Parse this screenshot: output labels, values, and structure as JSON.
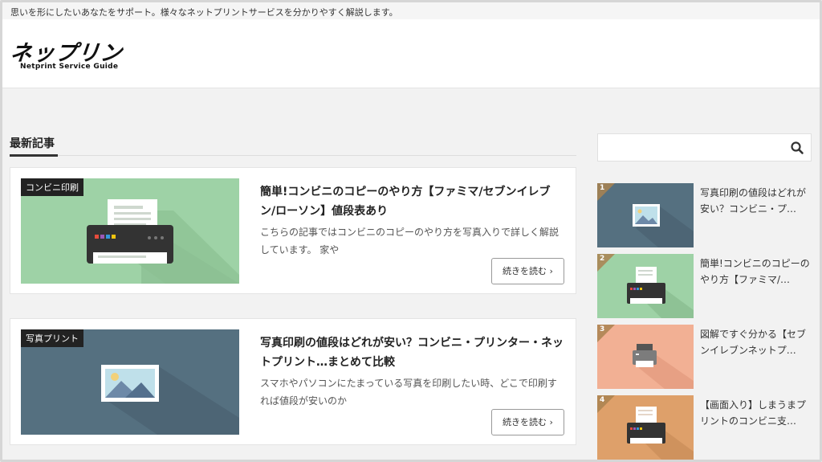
{
  "site": {
    "tagline": "思いを形にしたいあなたをサポート。様々なネットプリントサービスを分かりやすく解説します。",
    "logo_main": "ネップリン",
    "logo_sub": "Netprint Service Guide"
  },
  "main": {
    "section_title": "最新記事",
    "articles": [
      {
        "category": "コンビニ印刷",
        "title": "簡単!コンビニのコピーのやり方【ファミマ/セブンイレブン/ローソン】値段表あり",
        "excerpt": "こちらの記事ではコンビニのコピーのやり方を写真入りで詳しく解説しています。 家や",
        "more_label": "続きを読む ›",
        "thumb_bg": "#9ed2a6",
        "thumb_icon": "printer-icon"
      },
      {
        "category": "写真プリント",
        "title": "写真印刷の値段はどれが安い？コンビニ・プリンター・ネットプリント…まとめて比較",
        "excerpt": "スマホやパソコンにたまっている写真を印刷したい時、どこで印刷すれば値段が安いのか",
        "more_label": "続きを読む ›",
        "thumb_bg": "#557080",
        "thumb_icon": "photo-icon"
      }
    ]
  },
  "sidebar": {
    "search_placeholder": "",
    "ranking": [
      {
        "rank": "1",
        "title": "写真印刷の値段はどれが安い？コンビニ・プ…",
        "thumb_bg": "#557080",
        "thumb_icon": "photo-icon"
      },
      {
        "rank": "2",
        "title": "簡単!コンビニのコピーのやり方【ファミマ/…",
        "thumb_bg": "#9ed2a6",
        "thumb_icon": "printer-icon"
      },
      {
        "rank": "3",
        "title": "図解ですぐ分かる【セブンイレブンネットプ…",
        "thumb_bg": "#f2b094",
        "thumb_icon": "printer-small-icon"
      },
      {
        "rank": "4",
        "title": "【画面入り】しまうまプリントのコンビニ支…",
        "thumb_bg": "#dea06a",
        "thumb_icon": "printer-icon"
      }
    ]
  }
}
